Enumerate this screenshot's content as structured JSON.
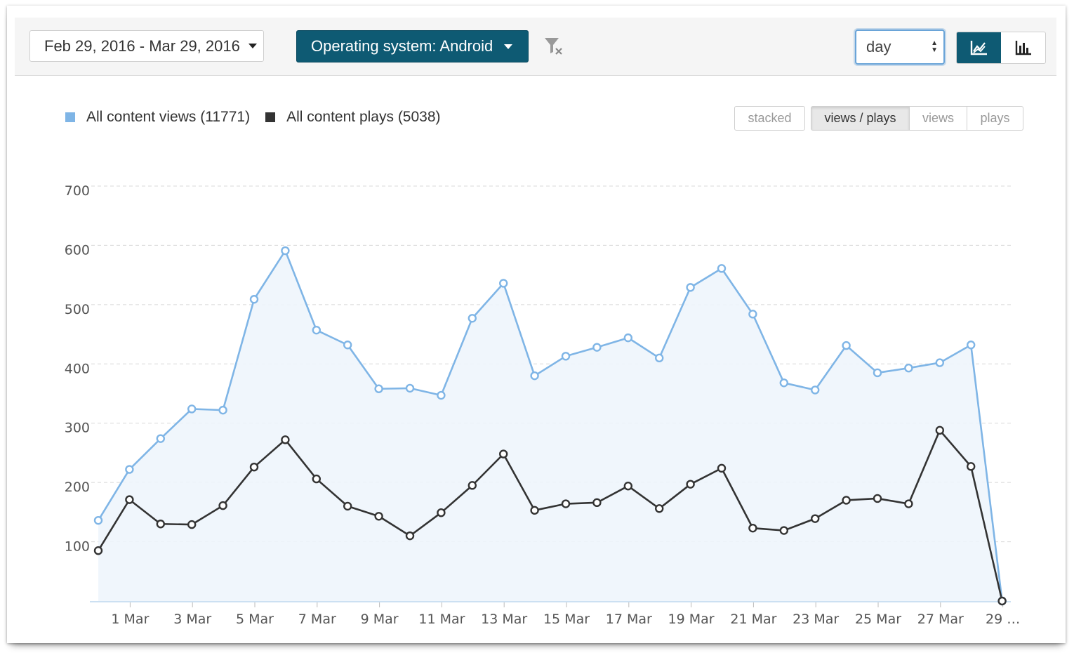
{
  "toolbar": {
    "date_range": "Feb 29, 2016 - Mar 29, 2016",
    "os_filter": "Operating system: Android",
    "granularity": "day",
    "clear_filter_icon": "filter-clear-icon",
    "line_chart_icon": "line-chart-icon",
    "bar_chart_icon": "bar-chart-icon",
    "active_view": "line",
    "accent_color": "#0e5a73"
  },
  "legend": {
    "views_label": "All content views (11771)",
    "plays_label": "All content plays (5038)",
    "views_color": "#7fb5e6",
    "plays_color": "#333333"
  },
  "modes": {
    "stacked": "stacked",
    "views_plays": "views / plays",
    "views": "views",
    "plays": "plays",
    "active": "views_plays"
  },
  "chart_data": {
    "type": "line",
    "x": [
      "29 Feb",
      "1 Mar",
      "2 Mar",
      "3 Mar",
      "4 Mar",
      "5 Mar",
      "6 Mar",
      "7 Mar",
      "8 Mar",
      "9 Mar",
      "10 Mar",
      "11 Mar",
      "12 Mar",
      "13 Mar",
      "14 Mar",
      "15 Mar",
      "16 Mar",
      "17 Mar",
      "18 Mar",
      "19 Mar",
      "20 Mar",
      "21 Mar",
      "22 Mar",
      "23 Mar",
      "24 Mar",
      "25 Mar",
      "26 Mar",
      "27 Mar",
      "28 Mar",
      "29 Mar"
    ],
    "tick_labels": [
      "1 Mar",
      "3 Mar",
      "5 Mar",
      "7 Mar",
      "9 Mar",
      "11 Mar",
      "13 Mar",
      "15 Mar",
      "17 Mar",
      "19 Mar",
      "21 Mar",
      "23 Mar",
      "25 Mar",
      "27 Mar",
      "29 …"
    ],
    "series": [
      {
        "name": "All content views (11771)",
        "values": [
          136,
          222,
          274,
          324,
          322,
          509,
          591,
          457,
          432,
          358,
          359,
          347,
          477,
          536,
          380,
          413,
          428,
          444,
          410,
          529,
          561,
          484,
          368,
          356,
          431,
          385,
          393,
          402,
          432,
          0
        ]
      },
      {
        "name": "All content plays (5038)",
        "values": [
          85,
          171,
          130,
          129,
          161,
          226,
          272,
          206,
          160,
          143,
          110,
          149,
          195,
          248,
          153,
          164,
          166,
          194,
          156,
          197,
          224,
          123,
          119,
          139,
          170,
          173,
          164,
          288,
          227,
          0
        ]
      }
    ],
    "yticks": [
      100,
      200,
      300,
      400,
      500,
      600,
      700
    ],
    "ylim": [
      0,
      700
    ],
    "grid": true,
    "area_fill": true
  }
}
